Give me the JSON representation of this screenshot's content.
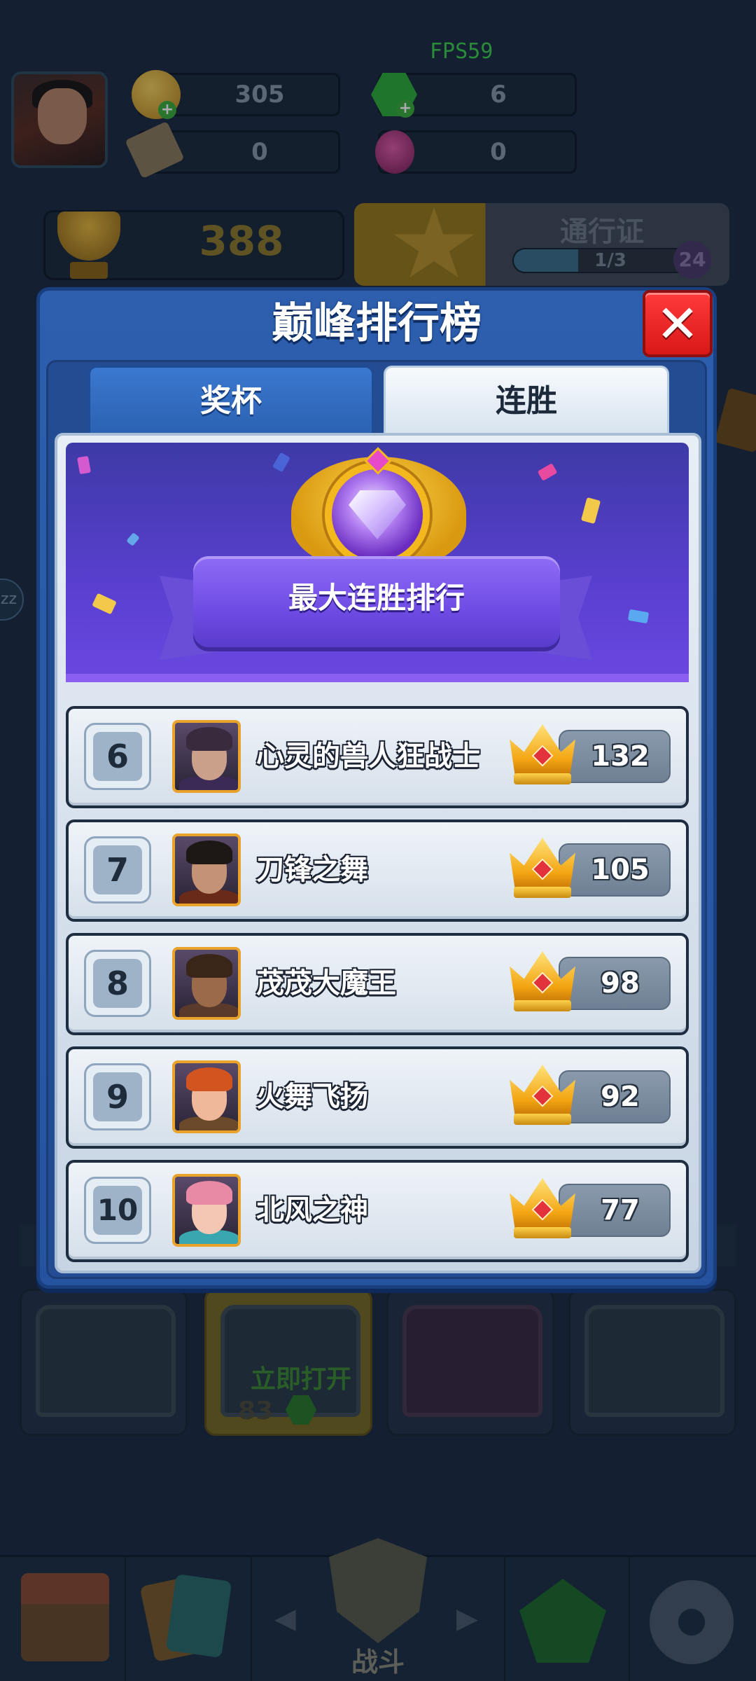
{
  "hud": {
    "fps": "FPS59",
    "coins": "305",
    "gems": "6",
    "tickets": "0",
    "potions": "0",
    "trophies": "388",
    "pass": {
      "title": "通行证",
      "progress_text": "1/3",
      "progress_fraction": 0.333,
      "level": "24"
    },
    "side_badge": "zz"
  },
  "chests": {
    "open_now_label": "立即打开",
    "open_cost": "83"
  },
  "bottom_nav": {
    "battle_label": "战斗",
    "prev_arrow": "◀",
    "next_arrow": "▶"
  },
  "modal": {
    "title": "巅峰排行榜",
    "close_icon": "close-x-icon",
    "close_symbol": "✕",
    "tabs": [
      {
        "label": "奖杯",
        "active": false
      },
      {
        "label": "连胜",
        "active": true
      }
    ],
    "banner_title": "最大连胜排行",
    "rows": [
      {
        "rank": "6",
        "name": "心灵的兽人狂战士",
        "score": "132",
        "avatar": {
          "hair": "#3a2a3e",
          "face": "#caa08a",
          "body": "#3b2a56"
        }
      },
      {
        "rank": "7",
        "name": "刀锋之舞",
        "score": "105",
        "avatar": {
          "hair": "#1d1715",
          "face": "#c49274",
          "body": "#6a2a1a"
        }
      },
      {
        "rank": "8",
        "name": "茂茂大魔王",
        "score": "98",
        "avatar": {
          "hair": "#3a2618",
          "face": "#9a6a4a",
          "body": "#5a3a2a"
        }
      },
      {
        "rank": "9",
        "name": "火舞飞扬",
        "score": "92",
        "avatar": {
          "hair": "#d2541e",
          "face": "#f0b89a",
          "body": "#6a4a2a"
        }
      },
      {
        "rank": "10",
        "name": "北风之神",
        "score": "77",
        "avatar": {
          "hair": "#e88aa6",
          "face": "#f4c6b4",
          "body": "#3aa6b0"
        }
      }
    ]
  },
  "colors": {
    "modal_blue": "#2d5fae",
    "close_red": "#e52222",
    "banner_purple": "#5a3fd0",
    "crown_gold": "#f3a512",
    "avatar_frame": "#e9a22a"
  }
}
